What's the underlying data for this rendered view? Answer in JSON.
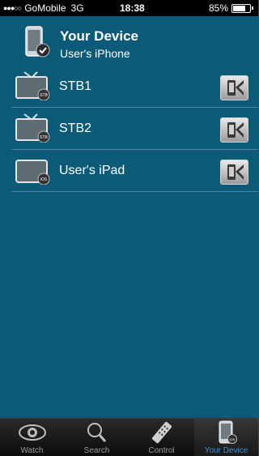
{
  "status_bar": {
    "signal_dots": "●●●○○",
    "carrier": "GoMobile",
    "network": "3G",
    "time": "18:38",
    "battery_text": "85%",
    "battery_level": 0.85
  },
  "header": {
    "title": "Your Device",
    "subtitle": "User's iPhone"
  },
  "devices": [
    {
      "label": "STB1",
      "badge": "STB"
    },
    {
      "label": "STB2",
      "badge": "STB"
    },
    {
      "label": "User's iPad",
      "badge": "iOS"
    }
  ],
  "tabs": [
    {
      "label": "Watch",
      "icon": "eye-icon",
      "active": false
    },
    {
      "label": "Search",
      "icon": "magnifier-icon",
      "active": false
    },
    {
      "label": "Control",
      "icon": "remote-icon",
      "active": false
    },
    {
      "label": "Your Device",
      "icon": "phone-icon",
      "active": true
    }
  ],
  "colors": {
    "background": "#0b5a78",
    "active_tab": "#3f8fd8"
  }
}
